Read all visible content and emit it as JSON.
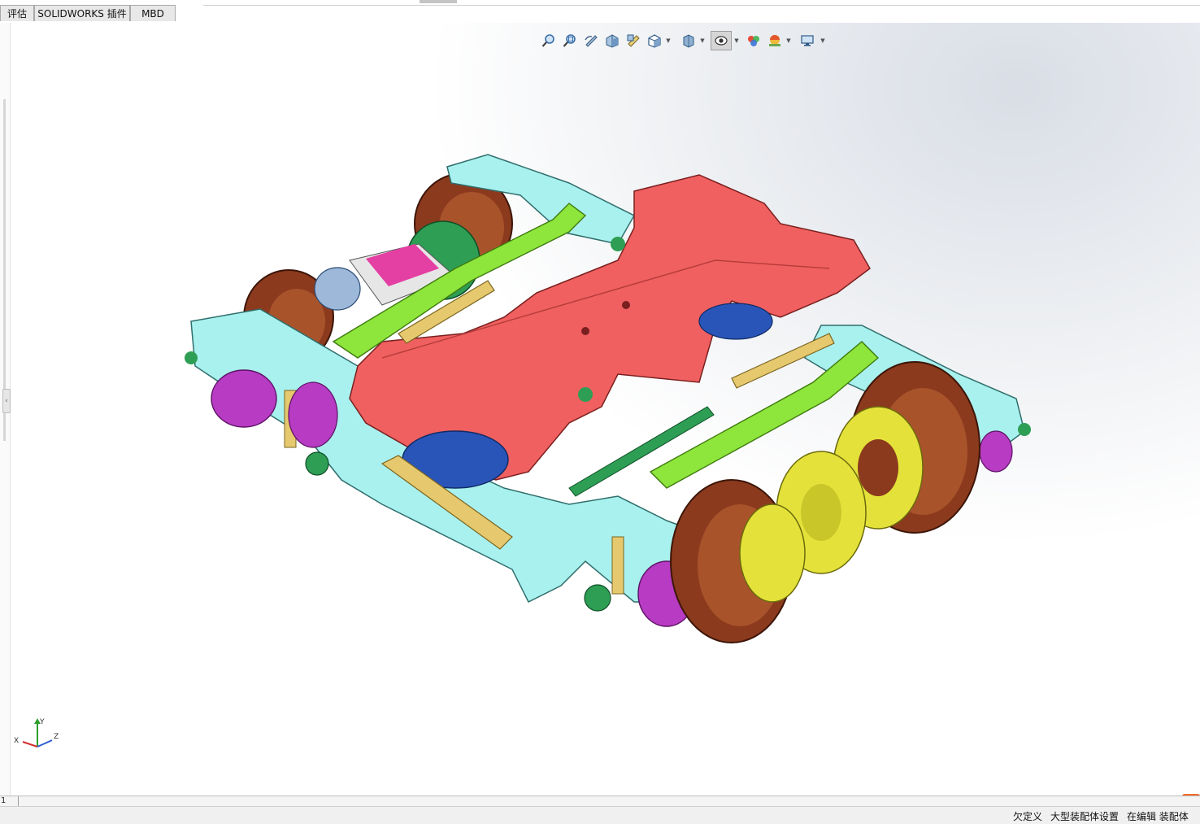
{
  "tabs": [
    {
      "label": "评估"
    },
    {
      "label": "SOLIDWORKS 插件"
    },
    {
      "label": "MBD"
    }
  ],
  "heads_up_toolbar": {
    "buttons": [
      {
        "icon": "zoom-to-fit-icon"
      },
      {
        "icon": "zoom-to-area-icon"
      },
      {
        "icon": "previous-view-icon"
      },
      {
        "icon": "section-view-icon"
      },
      {
        "icon": "dynamic-annotation-views-icon"
      },
      {
        "icon": "view-orientation-icon"
      },
      {
        "icon": "display-style-icon"
      },
      {
        "icon": "hide-show-items-icon"
      },
      {
        "icon": "edit-appearance-icon"
      },
      {
        "icon": "apply-scene-icon"
      },
      {
        "icon": "view-settings-icon"
      }
    ]
  },
  "model": {
    "description_colors": {
      "frame": "#a9f1ee",
      "bolster": "#f06060",
      "links": "#8ee53b",
      "wheels": "#8b3a1e",
      "discs": "#e4e23a",
      "springs": "#b73bc3",
      "airspring": "#2a55b8",
      "dampers": "#e6c96e",
      "motor": "#2e9e54"
    }
  },
  "triad": {
    "x_label": "X",
    "y_label": "Y",
    "z_label": "Z"
  },
  "bottom_strip": {
    "number": "1"
  },
  "status": {
    "definition": "欠定义",
    "large_assembly": "大型装配体设置",
    "editing": "在编辑 装配体"
  },
  "colors": {
    "tab_bg": "#e8e8e8",
    "viewport_gradient_center": "#d9dee6",
    "statusbar_bg": "#f0f0f0"
  }
}
